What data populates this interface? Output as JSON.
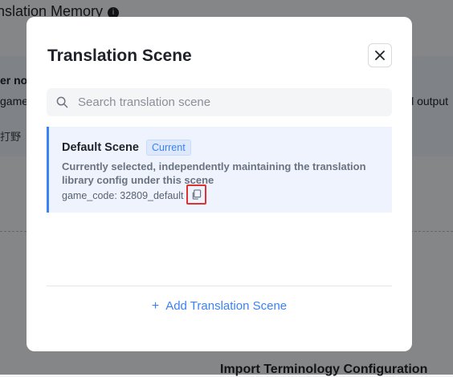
{
  "background": {
    "title": "nslation Memory",
    "line1": "er no",
    "line2_left": "game",
    "line2_right": "ill output",
    "line3": "打野",
    "bottom_heading": "Import Terminology Configuration"
  },
  "dialog": {
    "title": "Translation Scene",
    "close_icon": "close-icon",
    "search": {
      "placeholder": "Search translation scene",
      "value": ""
    },
    "scenes": [
      {
        "name": "Default Scene",
        "badge": "Current",
        "description": "Currently selected, independently maintaining the translation library config under this scene",
        "code": "game_code: 32809_default"
      }
    ],
    "add_button_label": "Add Translation Scene"
  },
  "colors": {
    "accent": "#3b82f6",
    "highlight": "#e03131",
    "selected_bg": "#eef3fd"
  }
}
